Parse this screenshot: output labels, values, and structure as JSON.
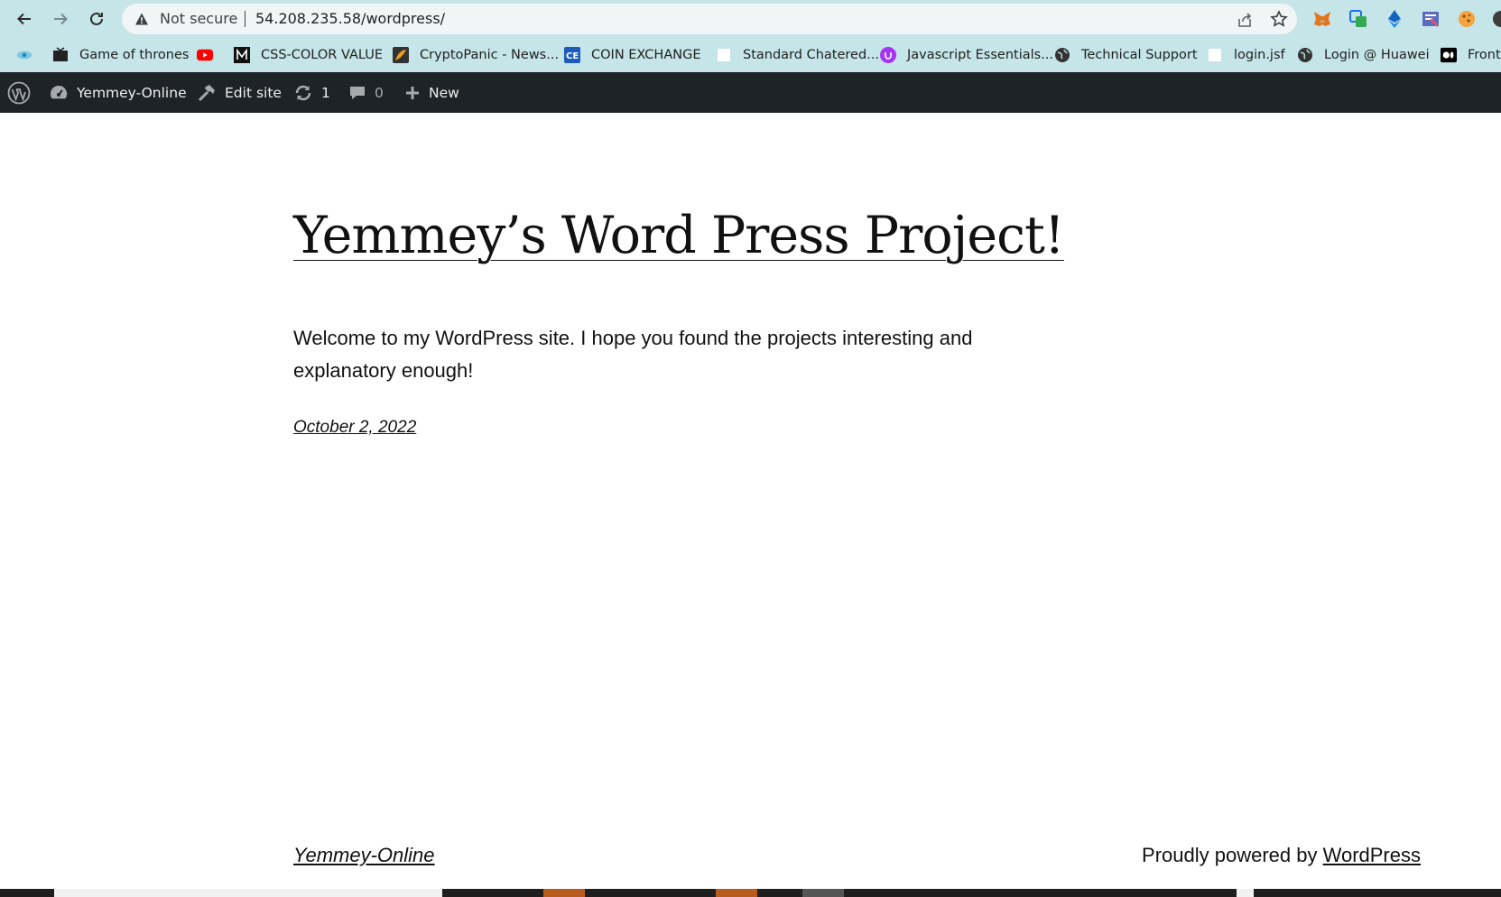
{
  "browser": {
    "security_label": "Not secure",
    "url": "54.208.235.58/wordpress/",
    "bookmarks": [
      {
        "label": "",
        "icon": "eye-icon"
      },
      {
        "label": "Game of thrones",
        "icon": "tv-icon"
      },
      {
        "label": "",
        "icon": "youtube-icon"
      },
      {
        "label": "CSS-COLOR VALUE",
        "icon": "m-logo-icon"
      },
      {
        "label": "CryptoPanic - News...",
        "icon": "cryptopanic-icon"
      },
      {
        "label": "COIN EXCHANGE",
        "icon": "ce-logo-icon"
      },
      {
        "label": "Standard Chatered...",
        "icon": "blank-page-icon"
      },
      {
        "label": "Javascript Essentials...",
        "icon": "udemy-icon"
      },
      {
        "label": "Technical Support",
        "icon": "globe-icon"
      },
      {
        "label": "login.jsf",
        "icon": "blank-page-icon"
      },
      {
        "label": "Login @ Huawei",
        "icon": "globe-icon"
      },
      {
        "label": "Front",
        "icon": "medium-icon"
      }
    ]
  },
  "adminbar": {
    "site_name": "Yemmey-Online",
    "edit_site": "Edit site",
    "updates_count": "1",
    "comments_count": "0",
    "new_label": "New"
  },
  "page": {
    "title": "Yemmey’s Word Press Project!",
    "content": "Welcome to my WordPress site. I hope you found the projects interesting and explanatory enough!",
    "date": "October 2, 2022"
  },
  "footer": {
    "site_name": "Yemmey-Online",
    "credit_prefix": "Proudly powered by ",
    "credit_link": "WordPress"
  },
  "colors": {
    "chrome_bg": "#c5e5e8",
    "adminbar_bg": "#1d2327",
    "text": "#111111"
  }
}
